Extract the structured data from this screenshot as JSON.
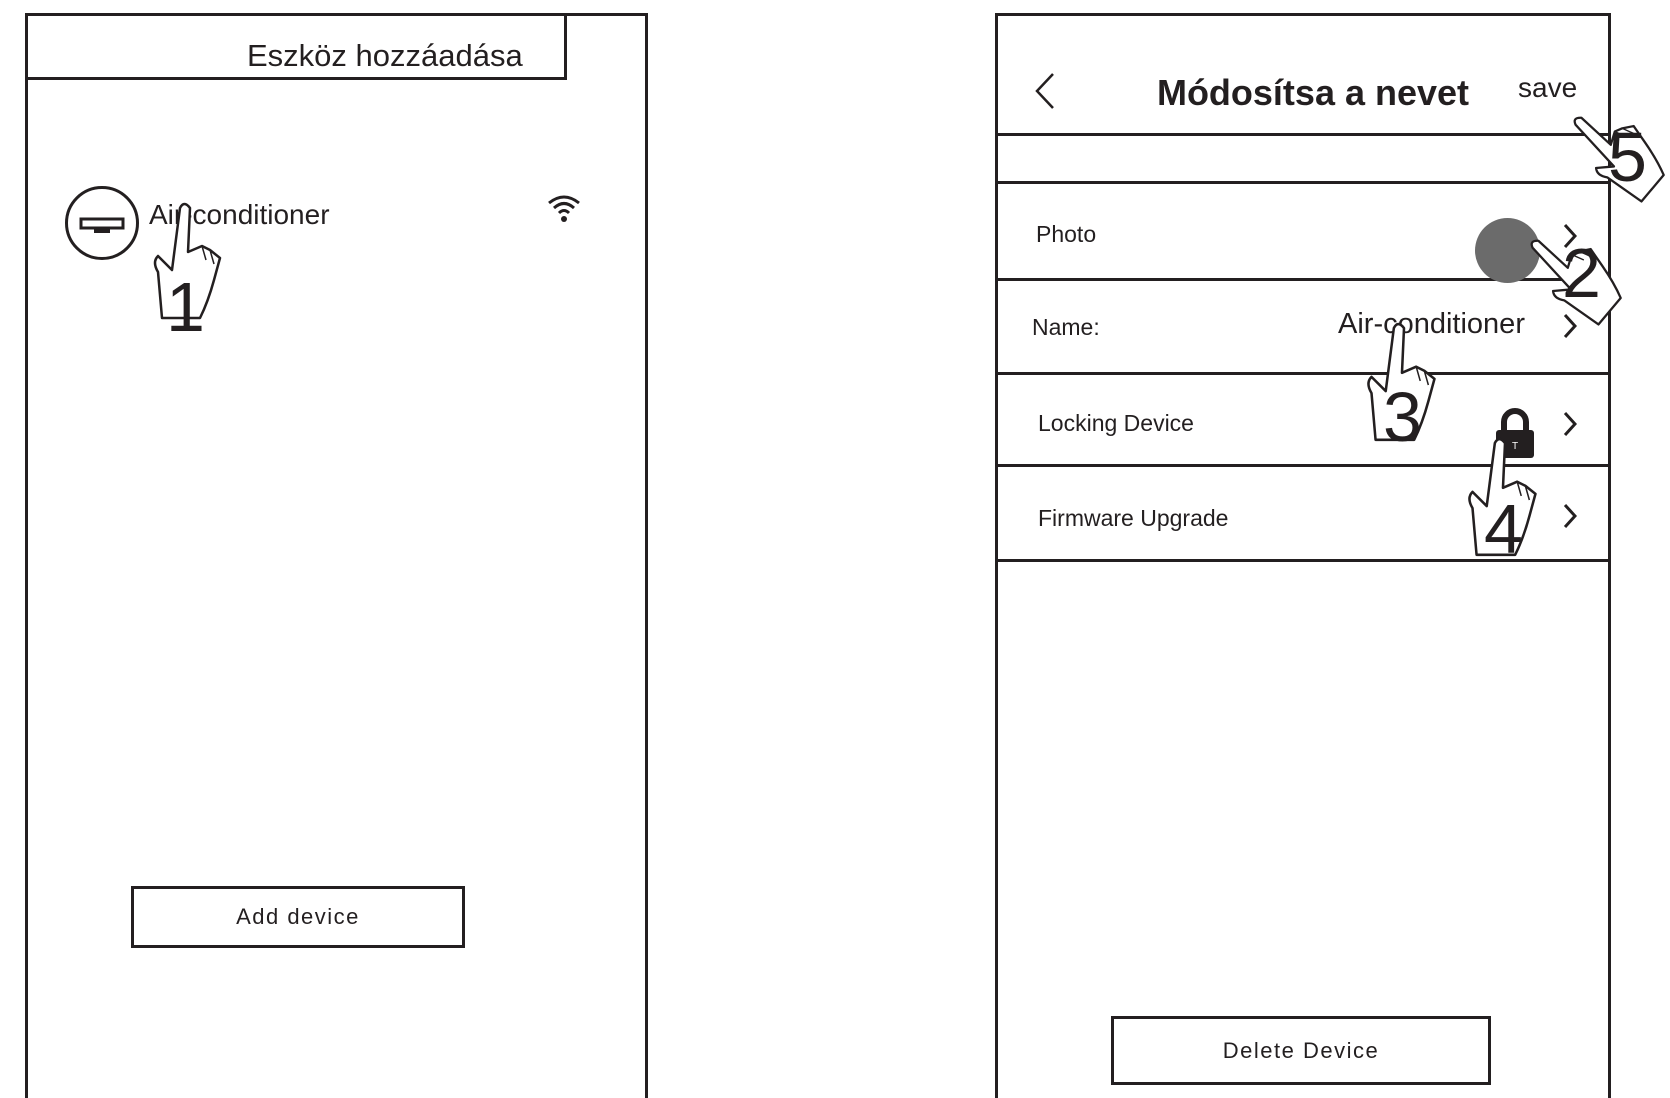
{
  "left_screen": {
    "title": "Eszköz hozzáadása",
    "device": {
      "name": "Air-conditioner",
      "icon": "air-conditioner-icon",
      "status_icon": "wifi-icon"
    },
    "add_device_label": "Add device"
  },
  "right_screen": {
    "back_icon": "back-chevron-icon",
    "title": "Módosítsa a nevet",
    "save_label": "save",
    "rows": [
      {
        "label": "Photo",
        "value_icon": "photo-avatar",
        "chevron": "chevron-right-icon"
      },
      {
        "label": "Name:",
        "value": "Air-conditioner",
        "chevron": "chevron-right-icon"
      },
      {
        "label": "Locking Device",
        "value_icon": "lock-icon",
        "chevron": "chevron-right-icon"
      },
      {
        "label": "Firmware Upgrade",
        "chevron": "chevron-right-icon"
      }
    ],
    "delete_device_label": "Delete Device"
  },
  "annotations": {
    "pointer_icon": "pointing-hand-icon",
    "steps": [
      "1",
      "2",
      "3",
      "4",
      "5"
    ]
  },
  "colors": {
    "line": "#231f20",
    "avatar": "#6b6b6b",
    "background": "#ffffff"
  }
}
